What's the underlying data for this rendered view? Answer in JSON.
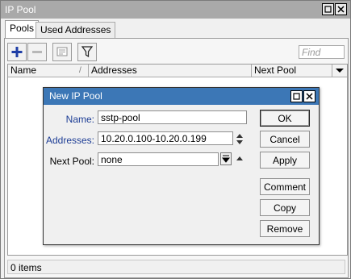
{
  "window": {
    "title": "IP Pool",
    "restore_glyph": "☐",
    "close_glyph": "✕"
  },
  "tabs": [
    {
      "label": "Pools",
      "active": true
    },
    {
      "label": "Used Addresses",
      "active": false
    }
  ],
  "toolbar": {
    "add_icon": "plus-icon",
    "remove_icon": "minus-icon",
    "comment_icon": "note-icon",
    "filter_icon": "filter-icon",
    "find_placeholder": "Find"
  },
  "table": {
    "columns": [
      "Name",
      "Addresses",
      "Next Pool"
    ],
    "sort_glyph": "/",
    "rows": []
  },
  "status_text": "0 items",
  "dialog": {
    "title": "New IP Pool",
    "restore_glyph": "☐",
    "close_glyph": "✕",
    "fields": {
      "name": {
        "label": "Name:",
        "value": "sstp-pool"
      },
      "addresses": {
        "label": "Addresses:",
        "value": "10.20.0.100-10.20.0.199"
      },
      "next_pool": {
        "label": "Next Pool:",
        "value": "none"
      }
    },
    "buttons": {
      "ok": "OK",
      "cancel": "Cancel",
      "apply": "Apply",
      "comment": "Comment",
      "copy": "Copy",
      "remove": "Remove"
    }
  },
  "colors": {
    "dialog_title_bg": "#3c77b6",
    "window_title_bg": "#a9a9a9",
    "label_blue": "#1d3d95",
    "add_blue": "#1f3ea6"
  }
}
